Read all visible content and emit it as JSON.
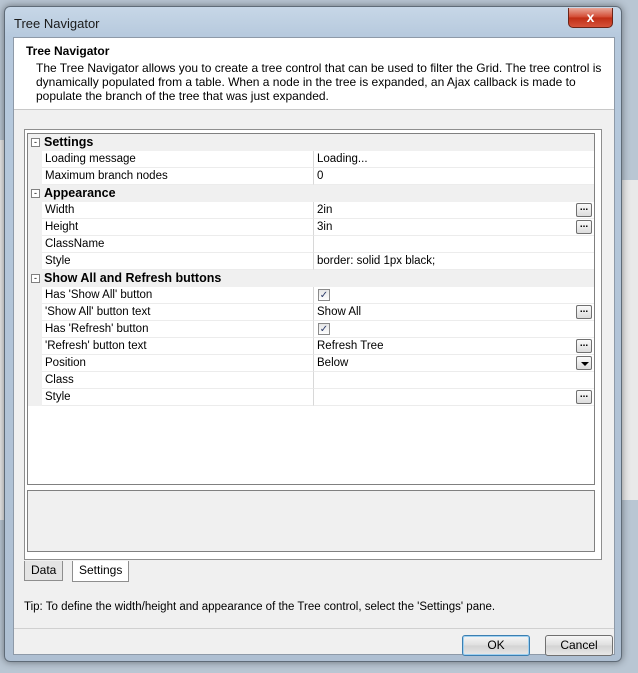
{
  "window": {
    "title": "Tree Navigator",
    "close_label": "x"
  },
  "header": {
    "title": "Tree Navigator",
    "description": "The Tree Navigator allows you to create a tree control that can be used to filter the Grid. The tree control is dynamically populated from a table. When a node in the tree is expanded, an Ajax callback is made to populate the branch of the tree that was just expanded."
  },
  "property_grid": {
    "sections": [
      {
        "label": "Settings",
        "toggle": "-",
        "rows": [
          {
            "name": "Loading message",
            "value": "Loading...",
            "control": "none"
          },
          {
            "name": "Maximum branch nodes",
            "value": "0",
            "control": "none"
          }
        ]
      },
      {
        "label": "Appearance",
        "toggle": "-",
        "rows": [
          {
            "name": "Width",
            "value": "2in",
            "control": "ellipsis"
          },
          {
            "name": "Height",
            "value": "3in",
            "control": "ellipsis"
          },
          {
            "name": "ClassName",
            "value": "",
            "control": "none"
          },
          {
            "name": "Style",
            "value": "border: solid 1px black;",
            "control": "none"
          }
        ]
      },
      {
        "label": "Show All and Refresh buttons",
        "toggle": "-",
        "rows": [
          {
            "name": "Has 'Show All' button",
            "value": "",
            "control": "checkbox",
            "checked": true
          },
          {
            "name": "'Show All' button text",
            "value": "Show All",
            "control": "ellipsis"
          },
          {
            "name": "Has 'Refresh' button",
            "value": "",
            "control": "checkbox",
            "checked": true
          },
          {
            "name": "'Refresh' button text",
            "value": "Refresh Tree",
            "control": "ellipsis"
          },
          {
            "name": "Position",
            "value": "Below",
            "control": "dropdown"
          },
          {
            "name": "Class",
            "value": "",
            "control": "none"
          },
          {
            "name": "Style",
            "value": "",
            "control": "ellipsis"
          }
        ]
      }
    ],
    "ellipsis_label": "...",
    "check_mark": "✓"
  },
  "tabs": [
    {
      "label": "Data",
      "active": false
    },
    {
      "label": "Settings",
      "active": true
    }
  ],
  "tip": "Tip: To define the width/height and appearance of the Tree control, select the 'Settings' pane.",
  "buttons": {
    "ok": "OK",
    "cancel": "Cancel"
  },
  "colors": {
    "category_bg": "#f0f0f0",
    "title_bar": "#b6c9dd",
    "close_button": "#d2472f",
    "default_button_border": "#3c7fb1"
  }
}
